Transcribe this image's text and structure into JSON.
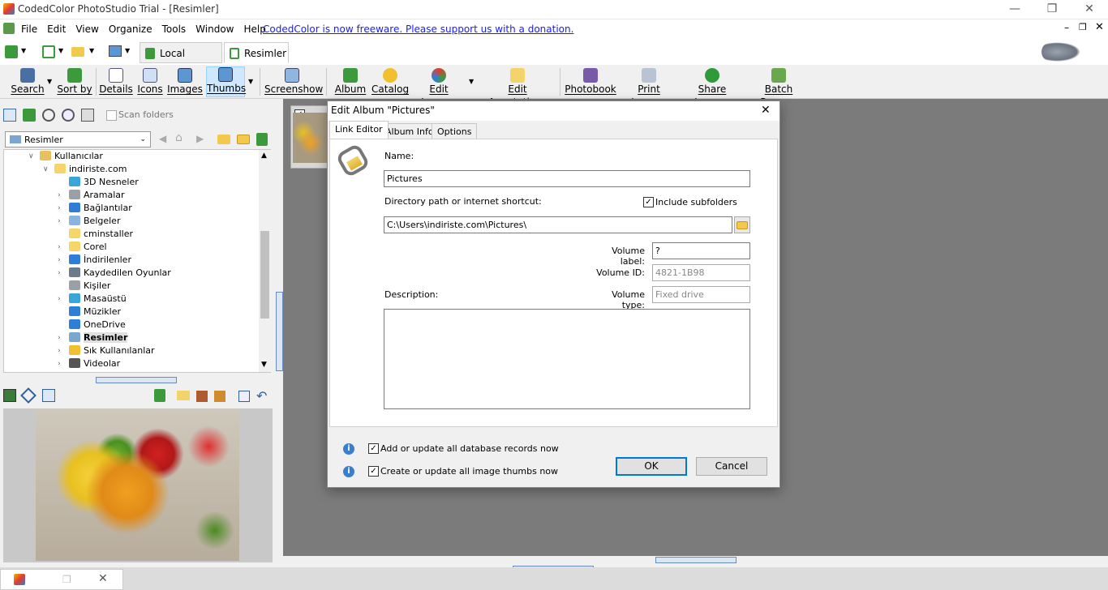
{
  "window": {
    "title": "CodedColor PhotoStudio Trial - [Resimler]"
  },
  "menu": {
    "items": [
      "File",
      "Edit",
      "View",
      "Organize",
      "Tools",
      "Window",
      "Help"
    ],
    "freeware_link": "CodedColor is now freeware. Please support us with a donation."
  },
  "tabs": {
    "local_albums": "Local Albums",
    "resimler": "Resimler"
  },
  "toolbar": {
    "search": "Search",
    "sort_by": "Sort by",
    "details": "Details",
    "icons": "Icons",
    "images": "Images",
    "thumbs": "Thumbs",
    "screenshow": "Screenshow",
    "album": "Album",
    "catalog": "Catalog",
    "edit_images": "Edit Images",
    "edit_annotations": "Edit Annotations",
    "photobook": "Photobook",
    "print_images": "Print Images",
    "share_images": "Share Images",
    "batch_process": "Batch Process"
  },
  "leftpanel": {
    "scan_folders": "Scan folders",
    "folder_select": "Resimler"
  },
  "tree": {
    "items": [
      {
        "label": "Kullanıcılar",
        "color": "#e8c060"
      },
      {
        "label": "indiriste.com",
        "color": "#f5d66b"
      },
      {
        "label": "3D Nesneler",
        "color": "#3aa6d8"
      },
      {
        "label": "Aramalar",
        "color": "#9aa0a6"
      },
      {
        "label": "Bağlantılar",
        "color": "#2f7ed8"
      },
      {
        "label": "Belgeler",
        "color": "#8ab4e0"
      },
      {
        "label": "cminstaller",
        "color": "#f5d66b"
      },
      {
        "label": "Corel",
        "color": "#f5d66b"
      },
      {
        "label": "İndirilenler",
        "color": "#2f7ed8"
      },
      {
        "label": "Kaydedilen Oyunlar",
        "color": "#6d7b8a"
      },
      {
        "label": "Kişiler",
        "color": "#9aa0a6"
      },
      {
        "label": "Masaüstü",
        "color": "#3aa6d8"
      },
      {
        "label": "Müzikler",
        "color": "#2f7ed8"
      },
      {
        "label": "OneDrive",
        "color": "#2f7ed8"
      },
      {
        "label": "Resimler",
        "color": "#7aa7cf"
      },
      {
        "label": "Sık Kullanılanlar",
        "color": "#f0c030"
      },
      {
        "label": "Videolar",
        "color": "#555555"
      }
    ]
  },
  "dialog": {
    "title": "Edit Album \"Pictures\"",
    "tabs": [
      "Link Editor",
      "Album Info",
      "Options"
    ],
    "name_label": "Name:",
    "name_value": "Pictures",
    "dir_label": "Directory path or internet shortcut:",
    "include_subfolders": "Include subfolders",
    "dir_value": "C:\\Users\\indiriste.com\\Pictures\\",
    "volume_label_label": "Volume label:",
    "volume_label_value": "?",
    "volume_id_label": "Volume ID:",
    "volume_id_value": "4821-1B98",
    "volume_type_label": "Volume type:",
    "volume_type_value": "Fixed drive",
    "description_label": "Description:",
    "db_records": "Add or update all database records now",
    "image_thumbs": "Create or update all image thumbs now",
    "ok": "OK",
    "cancel": "Cancel"
  }
}
